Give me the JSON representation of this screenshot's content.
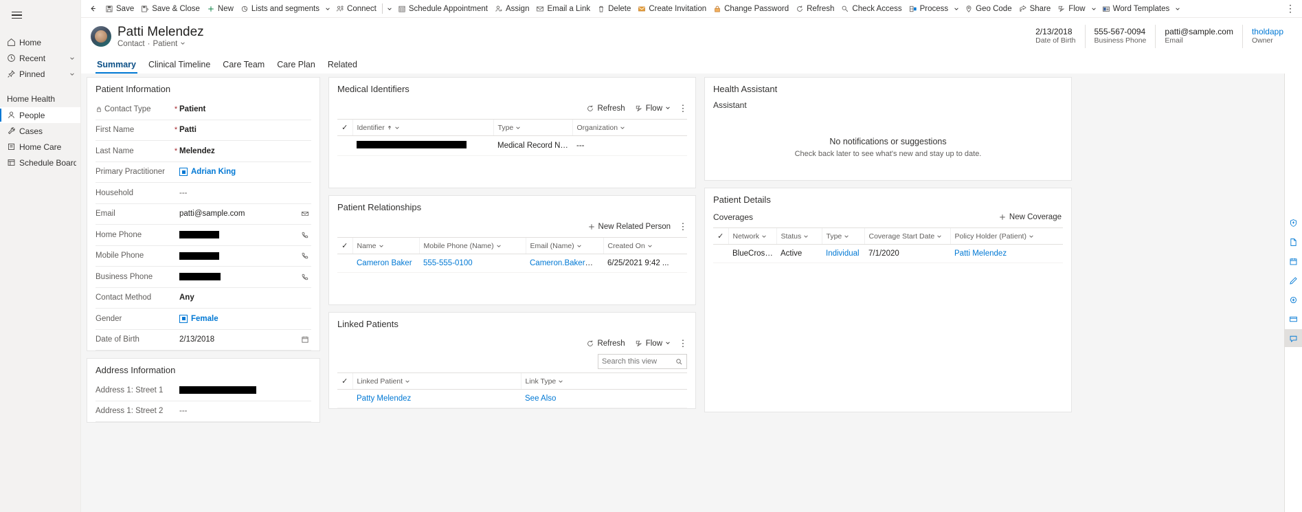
{
  "sidebar": {
    "menu_icon": "hamburger-icon",
    "top_items": [
      {
        "label": "Home",
        "icon": "home-icon",
        "chevron": false
      },
      {
        "label": "Recent",
        "icon": "clock-icon",
        "chevron": true
      },
      {
        "label": "Pinned",
        "icon": "pin-icon",
        "chevron": true
      }
    ],
    "group_title": "Home Health",
    "group_items": [
      {
        "label": "People",
        "icon": "person-icon",
        "selected": true
      },
      {
        "label": "Cases",
        "icon": "wrench-icon",
        "selected": false
      },
      {
        "label": "Home Care",
        "icon": "clipboard-icon",
        "selected": false
      },
      {
        "label": "Schedule Board",
        "icon": "board-icon",
        "selected": false
      }
    ]
  },
  "commandbar": {
    "back_icon": "back-arrow-icon",
    "items": [
      {
        "label": "Save",
        "icon": "save-icon",
        "chevron": false
      },
      {
        "label": "Save & Close",
        "icon": "save-close-icon",
        "chevron": false
      },
      {
        "label": "New",
        "icon": "plus-icon",
        "chevron": false
      },
      {
        "label": "Lists and segments",
        "icon": "segments-icon",
        "chevron": true
      },
      {
        "label": "Connect",
        "icon": "connect-icon",
        "chevron": true,
        "separator_before_chevron": true
      },
      {
        "label": "Schedule Appointment",
        "icon": "calendar-grid-icon",
        "chevron": false
      },
      {
        "label": "Assign",
        "icon": "assign-person-icon",
        "chevron": false
      },
      {
        "label": "Email a Link",
        "icon": "email-link-icon",
        "chevron": false
      },
      {
        "label": "Delete",
        "icon": "trash-icon",
        "chevron": false
      },
      {
        "label": "Create Invitation",
        "icon": "invitation-icon",
        "chevron": false
      },
      {
        "label": "Change Password",
        "icon": "lock-icon",
        "chevron": false
      },
      {
        "label": "Refresh",
        "icon": "refresh-icon",
        "chevron": false
      },
      {
        "label": "Check Access",
        "icon": "key-icon",
        "chevron": false
      },
      {
        "label": "Process",
        "icon": "process-icon",
        "chevron": true
      },
      {
        "label": "Geo Code",
        "icon": "location-pin-icon",
        "chevron": false
      },
      {
        "label": "Share",
        "icon": "share-icon",
        "chevron": false
      },
      {
        "label": "Flow",
        "icon": "flow-icon",
        "chevron": true
      },
      {
        "label": "Word Templates",
        "icon": "word-template-icon",
        "chevron": true
      }
    ],
    "overflow_label": "⋮"
  },
  "record_header": {
    "avatar": "patient-avatar",
    "name": "Patti Melendez",
    "entity": "Contact",
    "separator": "·",
    "form_name": "Patient",
    "fields": [
      {
        "value": "2/13/2018",
        "label": "Date of Birth",
        "link": false
      },
      {
        "value": "555-567-0094",
        "label": "Business Phone",
        "link": false
      },
      {
        "value": "patti@sample.com",
        "label": "Email",
        "link": false
      },
      {
        "value": "tholdapp",
        "label": "Owner",
        "link": true
      }
    ]
  },
  "tabs": [
    {
      "label": "Summary",
      "active": true
    },
    {
      "label": "Clinical Timeline",
      "active": false
    },
    {
      "label": "Care Team",
      "active": false
    },
    {
      "label": "Care Plan",
      "active": false
    },
    {
      "label": "Related",
      "active": false
    }
  ],
  "patient_information": {
    "title": "Patient Information",
    "rows": [
      {
        "label": "Contact Type",
        "locked": true,
        "required": true,
        "value": "Patient",
        "kind": "text"
      },
      {
        "label": "First Name",
        "required": true,
        "value": "Patti",
        "kind": "text"
      },
      {
        "label": "Last Name",
        "required": true,
        "value": "Melendez",
        "kind": "text"
      },
      {
        "label": "Primary Practitioner",
        "value": "Adrian King",
        "kind": "lookup"
      },
      {
        "label": "Household",
        "value": "---",
        "kind": "muted"
      },
      {
        "label": "Email",
        "value": "patti@sample.com",
        "kind": "text",
        "action_icon": "send-email-icon"
      },
      {
        "label": "Home Phone",
        "value": "",
        "kind": "redacted",
        "redact_width": 58,
        "action_icon": "phone-icon"
      },
      {
        "label": "Mobile Phone",
        "value": "",
        "kind": "redacted",
        "redact_width": 58,
        "action_icon": "phone-icon"
      },
      {
        "label": "Business Phone",
        "value": "",
        "kind": "redacted",
        "redact_width": 60,
        "action_icon": "phone-icon"
      },
      {
        "label": "Contact Method",
        "value": "Any",
        "kind": "text"
      },
      {
        "label": "Gender",
        "value": "Female",
        "kind": "lookup"
      },
      {
        "label": "Date of Birth",
        "value": "2/13/2018",
        "kind": "plain",
        "action_icon": "calendar-icon"
      }
    ]
  },
  "address_information": {
    "title": "Address Information",
    "rows": [
      {
        "label": "Address 1: Street 1",
        "value": "",
        "kind": "redacted",
        "redact_width": 112
      },
      {
        "label": "Address 1: Street 2",
        "value": "---",
        "kind": "muted"
      }
    ]
  },
  "medical_identifiers": {
    "title": "Medical Identifiers",
    "toolbar": {
      "refresh": "Refresh",
      "flow": "Flow",
      "overflow": "⋮"
    },
    "columns": [
      "Identifier",
      "Type",
      "Organization"
    ],
    "sort_column": "Identifier",
    "rows": [
      {
        "identifier": "",
        "identifier_redacted": true,
        "redact_width": 160,
        "type": "Medical Record Number",
        "organization": "---"
      }
    ]
  },
  "patient_relationships": {
    "title": "Patient Relationships",
    "toolbar": {
      "new_related_person": "New Related Person",
      "overflow": "⋮"
    },
    "columns": [
      "Name",
      "Mobile Phone (Name)",
      "Email (Name)",
      "Created On"
    ],
    "rows": [
      {
        "name": "Cameron Baker",
        "mobile_phone": "555-555-0100",
        "email": "Cameron.Baker@contoso.com",
        "created_on": "6/25/2021 9:42 ..."
      }
    ]
  },
  "linked_patients": {
    "title": "Linked Patients",
    "toolbar": {
      "refresh": "Refresh",
      "flow": "Flow",
      "overflow": "⋮"
    },
    "search_placeholder": "Search this view",
    "search_value": "",
    "columns": [
      "Linked Patient",
      "Link Type"
    ],
    "rows": [
      {
        "linked_patient": "Patty Melendez",
        "link_type": "See Also"
      }
    ]
  },
  "health_assistant": {
    "title": "Health Assistant",
    "subtitle": "Assistant",
    "empty_title": "No notifications or suggestions",
    "empty_subtitle": "Check back later to see what's new and stay up to date."
  },
  "patient_details": {
    "title": "Patient Details",
    "section_title": "Coverages",
    "new_coverage_label": "New Coverage",
    "columns": [
      "Network",
      "Status",
      "Type",
      "Coverage Start Date",
      "Policy Holder (Patient)"
    ],
    "rows": [
      {
        "network": "BlueCross ...",
        "status": "Active",
        "type": "Individual",
        "start_date": "7/1/2020",
        "policy_holder": "Patti Melendez"
      }
    ]
  },
  "right_rail": [
    {
      "icon": "shield-heart-icon",
      "active": false
    },
    {
      "icon": "document-icon",
      "active": false
    },
    {
      "icon": "calendar-rail-icon",
      "active": false
    },
    {
      "icon": "pen-icon",
      "active": false
    },
    {
      "icon": "pill-icon",
      "active": false
    },
    {
      "icon": "card-icon",
      "active": false
    },
    {
      "icon": "assistant-icon",
      "active": true
    }
  ],
  "colors": {
    "accent": "#0078d4",
    "required": "#a4262c",
    "canvas": "#f5f5f5",
    "sidebar": "#f3f2f1"
  }
}
